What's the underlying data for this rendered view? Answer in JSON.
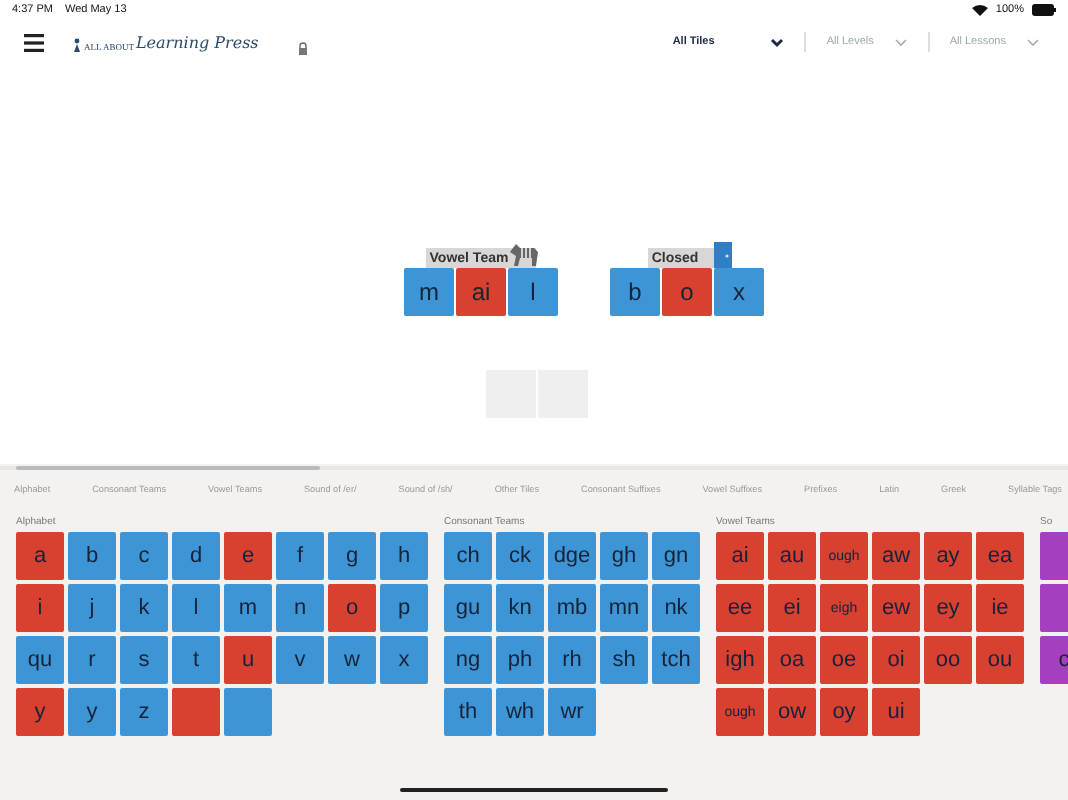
{
  "status_bar": {
    "time": "4:37 PM",
    "date": "Wed May 13",
    "battery": "100%"
  },
  "header": {
    "logo_small": "ALL ABOUT",
    "logo_script": "Learning Press",
    "filters": [
      {
        "label": "All Tiles",
        "selected": true
      },
      {
        "label": "All Levels",
        "selected": false
      },
      {
        "label": "All Lessons",
        "selected": false
      }
    ]
  },
  "words": [
    {
      "label": "Vowel Team",
      "tiles": [
        {
          "text": "m",
          "color": "#3e95d5"
        },
        {
          "text": "ai",
          "color": "#d8402f"
        },
        {
          "text": "l",
          "color": "#3e95d5"
        }
      ]
    },
    {
      "label": "Closed",
      "tiles": [
        {
          "text": "b",
          "color": "#3e95d5"
        },
        {
          "text": "o",
          "color": "#d8402f"
        },
        {
          "text": "x",
          "color": "#3e95d5"
        }
      ]
    }
  ],
  "categories": [
    {
      "label": "Alphabet",
      "selected": false
    },
    {
      "label": "Consonant Teams",
      "selected": false
    },
    {
      "label": "Vowel Teams",
      "selected": false
    },
    {
      "label": "Sound of /er/",
      "selected": false
    },
    {
      "label": "Sound of /sh/",
      "selected": false
    },
    {
      "label": "Other Tiles",
      "selected": false
    },
    {
      "label": "Consonant Suffixes",
      "selected": false
    },
    {
      "label": "Vowel Suffixes",
      "selected": false
    },
    {
      "label": "Prefixes",
      "selected": false
    },
    {
      "label": "Latin",
      "selected": false
    },
    {
      "label": "Greek",
      "selected": false
    },
    {
      "label": "Syllable Tags",
      "selected": false
    }
  ],
  "sections": [
    {
      "title": "Alphabet",
      "tiles": [
        {
          "text": "a",
          "color": "#d8402f"
        },
        {
          "text": "b",
          "color": "#3e95d5"
        },
        {
          "text": "c",
          "color": "#3e95d5"
        },
        {
          "text": "d",
          "color": "#3e95d5"
        },
        {
          "text": "e",
          "color": "#d8402f"
        },
        {
          "text": "f",
          "color": "#3e95d5"
        },
        {
          "text": "g",
          "color": "#3e95d5"
        },
        {
          "text": "h",
          "color": "#3e95d5"
        },
        {
          "text": "i",
          "color": "#d8402f"
        },
        {
          "text": "j",
          "color": "#3e95d5"
        },
        {
          "text": "k",
          "color": "#3e95d5"
        },
        {
          "text": "l",
          "color": "#3e95d5"
        },
        {
          "text": "m",
          "color": "#3e95d5"
        },
        {
          "text": "n",
          "color": "#3e95d5"
        },
        {
          "text": "o",
          "color": "#d8402f"
        },
        {
          "text": "p",
          "color": "#3e95d5"
        },
        {
          "text": "qu",
          "color": "#3e95d5"
        },
        {
          "text": "r",
          "color": "#3e95d5"
        },
        {
          "text": "s",
          "color": "#3e95d5"
        },
        {
          "text": "t",
          "color": "#3e95d5"
        },
        {
          "text": "u",
          "color": "#d8402f"
        },
        {
          "text": "v",
          "color": "#3e95d5"
        },
        {
          "text": "w",
          "color": "#3e95d5"
        },
        {
          "text": "x",
          "color": "#3e95d5"
        },
        {
          "text": "y",
          "color": "#d8402f"
        },
        {
          "text": "y",
          "color": "#3e95d5"
        },
        {
          "text": "z",
          "color": "#3e95d5"
        },
        {
          "color": "#d8402f"
        },
        {
          "color": "#3e95d5"
        }
      ]
    },
    {
      "title": "Consonant Teams",
      "tiles": [
        {
          "text": "ch",
          "color": "#3e95d5"
        },
        {
          "text": "ck",
          "color": "#3e95d5"
        },
        {
          "text": "dge",
          "color": "#3e95d5"
        },
        {
          "text": "gh",
          "color": "#3e95d5"
        },
        {
          "text": "gn",
          "color": "#3e95d5"
        },
        {
          "text": "gu",
          "color": "#3e95d5"
        },
        {
          "text": "kn",
          "color": "#3e95d5"
        },
        {
          "text": "mb",
          "color": "#3e95d5"
        },
        {
          "text": "mn",
          "color": "#3e95d5"
        },
        {
          "text": "nk",
          "color": "#3e95d5"
        },
        {
          "text": "ng",
          "color": "#3e95d5"
        },
        {
          "text": "ph",
          "color": "#3e95d5"
        },
        {
          "text": "rh",
          "color": "#3e95d5"
        },
        {
          "text": "sh",
          "color": "#3e95d5"
        },
        {
          "text": "tch",
          "color": "#3e95d5"
        },
        {
          "text": "th",
          "color": "#3e95d5"
        },
        {
          "text": "wh",
          "color": "#3e95d5"
        },
        {
          "text": "wr",
          "color": "#3e95d5"
        }
      ]
    },
    {
      "title": "Vowel Teams",
      "tiles": [
        {
          "text": "ai",
          "color": "#d8402f"
        },
        {
          "text": "au",
          "color": "#d8402f"
        },
        {
          "text": "ough",
          "color": "#d8402f"
        },
        {
          "text": "aw",
          "color": "#d8402f"
        },
        {
          "text": "ay",
          "color": "#d8402f"
        },
        {
          "text": "ea",
          "color": "#d8402f"
        },
        {
          "text": "ee",
          "color": "#d8402f"
        },
        {
          "text": "ei",
          "color": "#d8402f"
        },
        {
          "text": "eigh",
          "color": "#d8402f"
        },
        {
          "text": "ew",
          "color": "#d8402f"
        },
        {
          "text": "ey",
          "color": "#d8402f"
        },
        {
          "text": "ie",
          "color": "#d8402f"
        },
        {
          "text": "igh",
          "color": "#d8402f"
        },
        {
          "text": "oa",
          "color": "#d8402f"
        },
        {
          "text": "oe",
          "color": "#d8402f"
        },
        {
          "text": "oi",
          "color": "#d8402f"
        },
        {
          "text": "oo",
          "color": "#d8402f"
        },
        {
          "text": "ou",
          "color": "#d8402f"
        },
        {
          "text": "ough",
          "color": "#d8402f"
        },
        {
          "text": "ow",
          "color": "#d8402f"
        },
        {
          "text": "oy",
          "color": "#d8402f"
        },
        {
          "text": "ui",
          "color": "#d8402f"
        }
      ]
    },
    {
      "title": "So",
      "tiles": [
        {
          "color": "#a43fc0"
        },
        {
          "color": "#a43fc0"
        },
        {
          "text": "c",
          "color": "#a43fc0"
        }
      ]
    }
  ]
}
